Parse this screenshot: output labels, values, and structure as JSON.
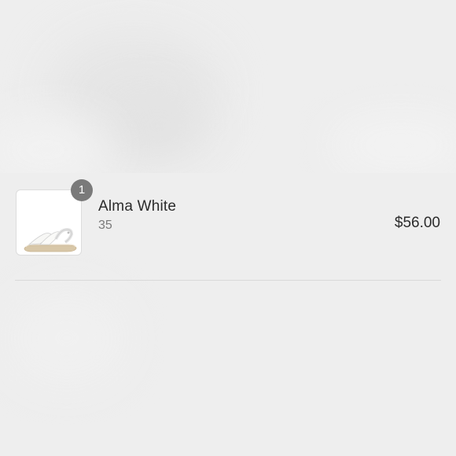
{
  "cart": {
    "items": [
      {
        "name": "Alma White",
        "variant": "35",
        "price": "$56.00",
        "quantity": "1",
        "thumbnail_icon": "sandal-product-image"
      }
    ]
  }
}
